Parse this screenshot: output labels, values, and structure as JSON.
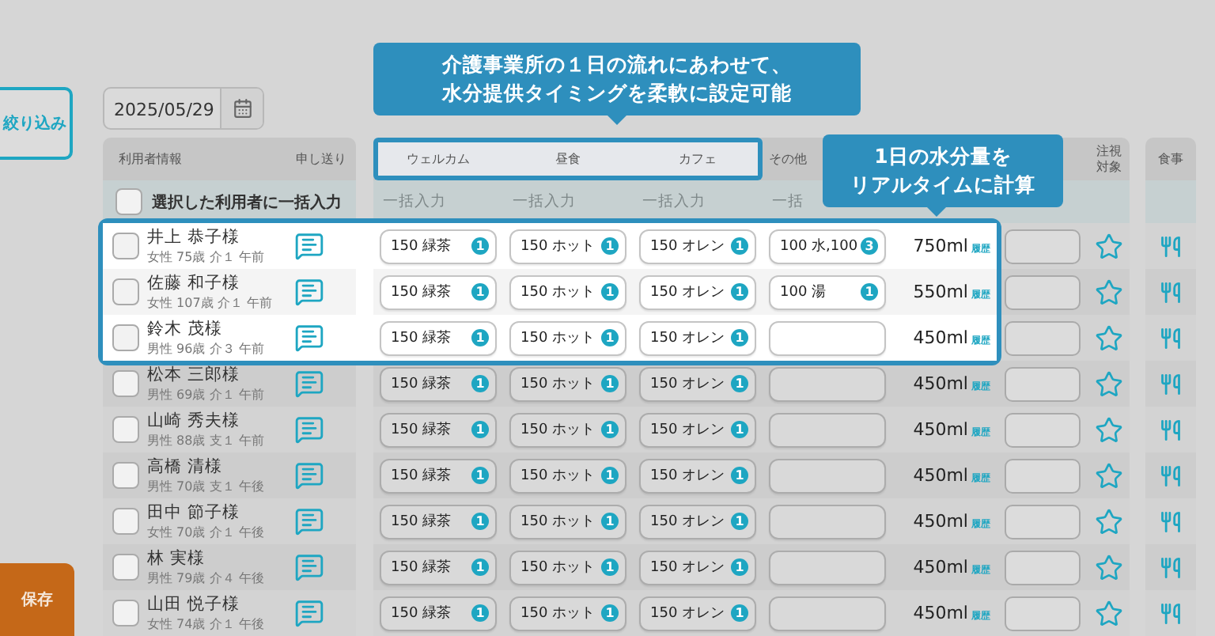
{
  "sidebar": {
    "filter_button": "絞り込み",
    "save_button": "保存"
  },
  "date": "2025/05/29",
  "callouts": [
    {
      "lines": [
        "介護事業所の１日の流れにあわせて、",
        "水分提供タイミングを柔軟に設定可能"
      ]
    },
    {
      "lines": [
        "1日の水分量を",
        "リアルタイムに計算"
      ]
    }
  ],
  "table": {
    "user_header": "利用者情報",
    "memo_header": "申し送り",
    "slot_headers": [
      {
        "label": "ウェルカム",
        "highlighted": true
      },
      {
        "label": "昼食",
        "highlighted": true
      },
      {
        "label": "カフェ",
        "highlighted": true
      },
      {
        "label": "その他",
        "highlighted": false
      }
    ],
    "watch_header": "注視対象",
    "meal_header": "食事",
    "bulk": {
      "label": "選択した利用者に一括入力",
      "checked": false,
      "slots": [
        "一括入力",
        "一括入力",
        "一括入力",
        "一括"
      ]
    },
    "rows": [
      {
        "name": "井上 恭子様",
        "info": "女性 75歳 介１ 午前",
        "checked": false,
        "highlighted": true,
        "slots": [
          {
            "text": "150 緑茶",
            "count": "1"
          },
          {
            "text": "150 ホット",
            "count": "1"
          },
          {
            "text": "150 オレン",
            "count": "1"
          },
          {
            "text": "100 水,100",
            "count": "3"
          }
        ],
        "total": "750ml",
        "history": "履歴"
      },
      {
        "name": "佐藤 和子様",
        "info": "女性 107歳 介１ 午前",
        "checked": false,
        "highlighted": true,
        "slots": [
          {
            "text": "150 緑茶",
            "count": "1"
          },
          {
            "text": "150 ホット",
            "count": "1"
          },
          {
            "text": "150 オレン",
            "count": "1"
          },
          {
            "text": "100 湯",
            "count": "1"
          }
        ],
        "total": "550ml",
        "history": "履歴"
      },
      {
        "name": "鈴木 茂様",
        "info": "男性 96歳 介３ 午前",
        "checked": false,
        "highlighted": true,
        "slots": [
          {
            "text": "150 緑茶",
            "count": "1"
          },
          {
            "text": "150 ホット",
            "count": "1"
          },
          {
            "text": "150 オレン",
            "count": "1"
          }
        ],
        "total": "450ml",
        "history": "履歴"
      },
      {
        "name": "松本 三郎様",
        "info": "男性 69歳 介１ 午前",
        "checked": false,
        "highlighted": false,
        "slots": [
          {
            "text": "150 緑茶",
            "count": "1"
          },
          {
            "text": "150 ホット",
            "count": "1"
          },
          {
            "text": "150 オレン",
            "count": "1"
          }
        ],
        "total": "450ml",
        "history": "履歴"
      },
      {
        "name": "山崎 秀夫様",
        "info": "男性 88歳 支１ 午前",
        "checked": false,
        "highlighted": false,
        "slots": [
          {
            "text": "150 緑茶",
            "count": "1"
          },
          {
            "text": "150 ホット",
            "count": "1"
          },
          {
            "text": "150 オレン",
            "count": "1"
          }
        ],
        "total": "450ml",
        "history": "履歴"
      },
      {
        "name": "高橋 清様",
        "info": "男性 70歳 支１ 午後",
        "checked": false,
        "highlighted": false,
        "slots": [
          {
            "text": "150 緑茶",
            "count": "1"
          },
          {
            "text": "150 ホット",
            "count": "1"
          },
          {
            "text": "150 オレン",
            "count": "1"
          }
        ],
        "total": "450ml",
        "history": "履歴"
      },
      {
        "name": "田中 節子様",
        "info": "女性 70歳 介１ 午後",
        "checked": false,
        "highlighted": false,
        "slots": [
          {
            "text": "150 緑茶",
            "count": "1"
          },
          {
            "text": "150 ホット",
            "count": "1"
          },
          {
            "text": "150 オレン",
            "count": "1"
          }
        ],
        "total": "450ml",
        "history": "履歴"
      },
      {
        "name": "林 実様",
        "info": "男性 79歳 介４ 午後",
        "checked": false,
        "highlighted": false,
        "slots": [
          {
            "text": "150 緑茶",
            "count": "1"
          },
          {
            "text": "150 ホット",
            "count": "1"
          },
          {
            "text": "150 オレン",
            "count": "1"
          }
        ],
        "total": "450ml",
        "history": "履歴"
      },
      {
        "name": "山田 悦子様",
        "info": "女性 74歳 介１ 午後",
        "checked": false,
        "highlighted": false,
        "slots": [
          {
            "text": "150 緑茶",
            "count": "1"
          },
          {
            "text": "150 ホット",
            "count": "1"
          },
          {
            "text": "150 オレン",
            "count": "1"
          }
        ],
        "total": "450ml",
        "history": "履歴"
      }
    ]
  }
}
